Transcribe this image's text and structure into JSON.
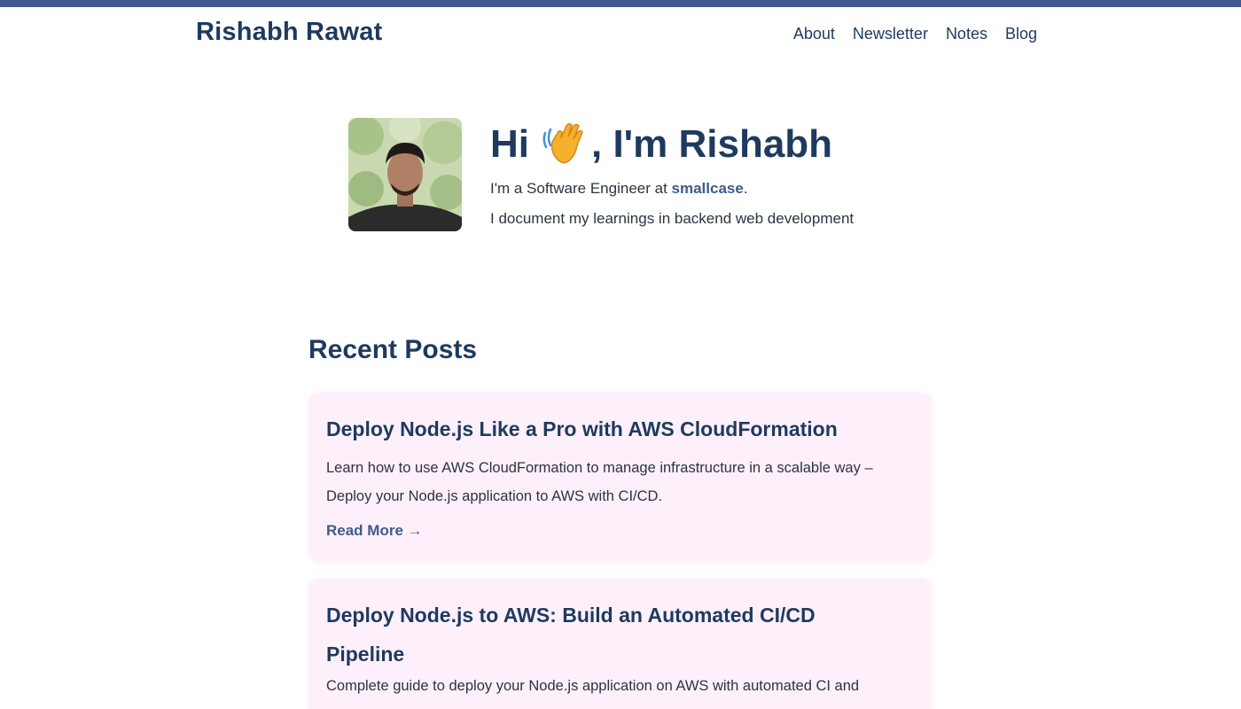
{
  "header": {
    "site_title": "Rishabh Rawat",
    "nav": [
      {
        "label": "About"
      },
      {
        "label": "Newsletter"
      },
      {
        "label": "Notes"
      },
      {
        "label": "Blog"
      }
    ]
  },
  "hero": {
    "greeting_prefix": "Hi",
    "greeting_icon": "waving-hand-icon",
    "greeting_suffix": ", I'm Rishabh",
    "line1_prefix": "I'm a Software Engineer at ",
    "company": "smallcase",
    "line1_suffix": ".",
    "line2": "I document my learnings in backend web development"
  },
  "recent": {
    "title": "Recent Posts",
    "posts": [
      {
        "title": "Deploy Node.js Like a Pro with AWS CloudFormation",
        "description": "Learn how to use AWS CloudFormation to manage infrastructure in a scalable way – Deploy your Node.js application to AWS with CI/CD.",
        "read_more": "Read More →"
      },
      {
        "title": "Deploy Node.js to AWS: Build an Automated CI/CD Pipeline",
        "description": "Complete guide to deploy your Node.js application on AWS with automated CI and"
      }
    ]
  },
  "colors": {
    "accent": "#3f5a8c",
    "heading": "#1e3a5f",
    "card_bg": "#fdf0fb"
  }
}
